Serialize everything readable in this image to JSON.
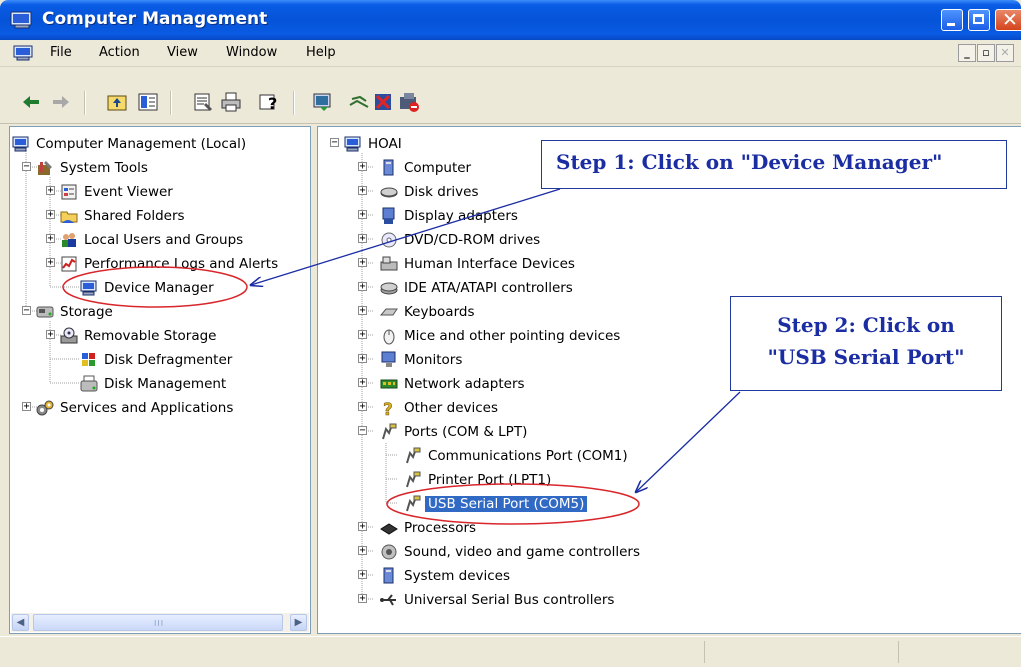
{
  "window": {
    "title": "Computer Management"
  },
  "menu": {
    "file": "File",
    "action": "Action",
    "view": "View",
    "window": "Window",
    "help": "Help"
  },
  "left_tree": {
    "root": "Computer Management (Local)",
    "system_tools": "System Tools",
    "event_viewer": "Event Viewer",
    "shared_folders": "Shared Folders",
    "local_users": "Local Users and Groups",
    "perf_logs": "Performance Logs and Alerts",
    "device_manager": "Device Manager",
    "storage": "Storage",
    "removable_storage": "Removable Storage",
    "disk_defrag": "Disk Defragmenter",
    "disk_management": "Disk Management",
    "services_apps": "Services and Applications"
  },
  "right_tree": {
    "root": "HOAI",
    "computer": "Computer",
    "disk_drives": "Disk drives",
    "display_adapters": "Display adapters",
    "dvd_drives": "DVD/CD-ROM drives",
    "hid": "Human Interface Devices",
    "ide": "IDE ATA/ATAPI controllers",
    "keyboards": "Keyboards",
    "mice": "Mice and other pointing devices",
    "monitors": "Monitors",
    "network": "Network adapters",
    "other": "Other devices",
    "ports": "Ports (COM & LPT)",
    "com1": "Communications Port (COM1)",
    "lpt1": "Printer Port (LPT1)",
    "com5": "USB Serial Port (COM5)",
    "processors": "Processors",
    "sound": "Sound, video and game controllers",
    "system_devices": "System devices",
    "usb": "Universal Serial Bus controllers"
  },
  "annotations": {
    "step1": "Step 1: Click on \"Device Manager\"",
    "step2_line1": "Step 2: Click on",
    "step2_line2": "\"USB Serial Port\"",
    "color": "#1b2da3",
    "highlight_color": "#d9262b"
  },
  "scrollbar": {
    "grip": "III"
  }
}
